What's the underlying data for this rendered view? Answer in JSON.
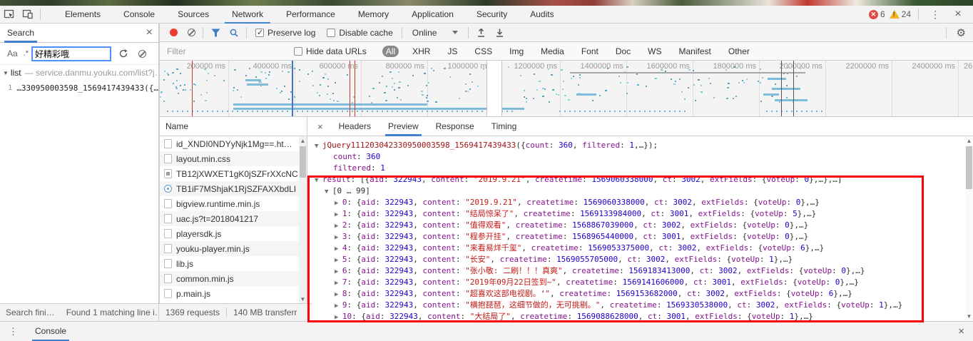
{
  "devtools": {
    "tabs": [
      "Elements",
      "Console",
      "Sources",
      "Network",
      "Performance",
      "Memory",
      "Application",
      "Security",
      "Audits"
    ],
    "active_tab": "Network",
    "error_count": "6",
    "warning_count": "24"
  },
  "search_panel": {
    "title": "Search",
    "match_case_label": "Aa",
    "regex_label": ".*",
    "query": "好精彩哦",
    "result_group_name": "list",
    "result_group_sep": "—",
    "result_group_url": "service.danmu.youku.com/list?j…",
    "result_line_number": "1",
    "result_line_text": "…330950003598_1569417439433({…",
    "status_left": "Search fini…",
    "status_right": "Found 1 matching line i…"
  },
  "network": {
    "preserve_log_label": "Preserve log",
    "disable_cache_label": "Disable cache",
    "throttling_value": "Online",
    "filter_placeholder": "Filter",
    "hide_data_urls_label": "Hide data URLs",
    "type_filters": [
      "All",
      "XHR",
      "JS",
      "CSS",
      "Img",
      "Media",
      "Font",
      "Doc",
      "WS",
      "Manifest",
      "Other"
    ],
    "active_type_filter": "All",
    "timeline_labels": [
      "200000 ms",
      "400000 ms",
      "600000 ms",
      "800000 ms",
      "1000000 ms",
      "1200000 ms",
      "1400000 ms",
      "1600000 ms",
      "1800000 ms",
      "2000000 ms",
      "2200000 ms",
      "2400000 ms"
    ],
    "timeline_label_partial": "26",
    "name_header": "Name",
    "requests": [
      {
        "name": "id_XNDI0NDYyNjk1Mg==.ht…",
        "icon": "doc"
      },
      {
        "name": "layout.min.css",
        "icon": "doc"
      },
      {
        "name": "TB12jXWXET1gK0jSZFrXXcNC",
        "icon": "img"
      },
      {
        "name": "TB1iF7MShjaK1RjSZFAXXbdLI",
        "icon": "circle"
      },
      {
        "name": "bigview.runtime.min.js",
        "icon": "doc"
      },
      {
        "name": "uac.js?t=2018041217",
        "icon": "doc"
      },
      {
        "name": "playersdk.js",
        "icon": "doc"
      },
      {
        "name": "youku-player.min.js",
        "icon": "doc"
      },
      {
        "name": "lib.js",
        "icon": "doc"
      },
      {
        "name": "common.min.js",
        "icon": "doc"
      },
      {
        "name": "p.main.js",
        "icon": "doc"
      }
    ],
    "summary_requests": "1369 requests",
    "summary_transferred": "140 MB transferr"
  },
  "preview": {
    "tabs": [
      "Headers",
      "Preview",
      "Response",
      "Timing"
    ],
    "active_tab": "Preview",
    "close_label": "×",
    "jsonp_function": "jQuery111203042330950003598_1569417439433",
    "count_key": "count",
    "count_value": "360",
    "filtered_key": "filtered",
    "filtered_value": "1",
    "result_key": "result",
    "range_label": "[0 … 99]",
    "items": [
      {
        "index": "0",
        "aid": "322943",
        "content": "2019.9.21",
        "createtime": "1569060338000",
        "ct": "3002",
        "voteUp": "0"
      },
      {
        "index": "1",
        "aid": "322943",
        "content": "结局惊呆了",
        "createtime": "1569133984000",
        "ct": "3001",
        "voteUp": "5"
      },
      {
        "index": "2",
        "aid": "322943",
        "content": "值得观看",
        "createtime": "1568867039000",
        "ct": "3002",
        "voteUp": "0"
      },
      {
        "index": "3",
        "aid": "322943",
        "content": "程参开挂",
        "createtime": "1568965440000",
        "ct": "3001",
        "voteUp": "0"
      },
      {
        "index": "4",
        "aid": "322943",
        "content": "来看易烊千玺",
        "createtime": "1569053375000",
        "ct": "3002",
        "voteUp": "6"
      },
      {
        "index": "5",
        "aid": "322943",
        "content": "长安",
        "createtime": "1569055705000",
        "ct": "3002",
        "voteUp": "1"
      },
      {
        "index": "6",
        "aid": "322943",
        "content": "张小敬: 二刷！！！真爽",
        "createtime": "1569183413000",
        "ct": "3002",
        "voteUp": "0"
      },
      {
        "index": "7",
        "aid": "322943",
        "content": "2019年09月22日签到~",
        "createtime": "1569141606000",
        "ct": "3001",
        "voteUp": "0"
      },
      {
        "index": "8",
        "aid": "322943",
        "content": "超喜欢这部电视剧。‘",
        "createtime": "1569153682000",
        "ct": "3002",
        "voteUp": "6"
      },
      {
        "index": "9",
        "aid": "322943",
        "content": "横抱琵琶，这细节做的，无可挑剔。",
        "createtime": "1569330538000",
        "ct": "3002",
        "voteUp": "1"
      },
      {
        "index": "10",
        "aid": "322943",
        "content": "大结局了",
        "createtime": "1569088628000",
        "ct": "3001",
        "voteUp": "1"
      }
    ]
  },
  "console_drawer": {
    "label": "Console"
  },
  "colors": {
    "accent_blue": "#437fd4",
    "record_red": "#e93c2e",
    "annotation_red": "#fb0007",
    "dot_teal": "#6fb3d0"
  }
}
